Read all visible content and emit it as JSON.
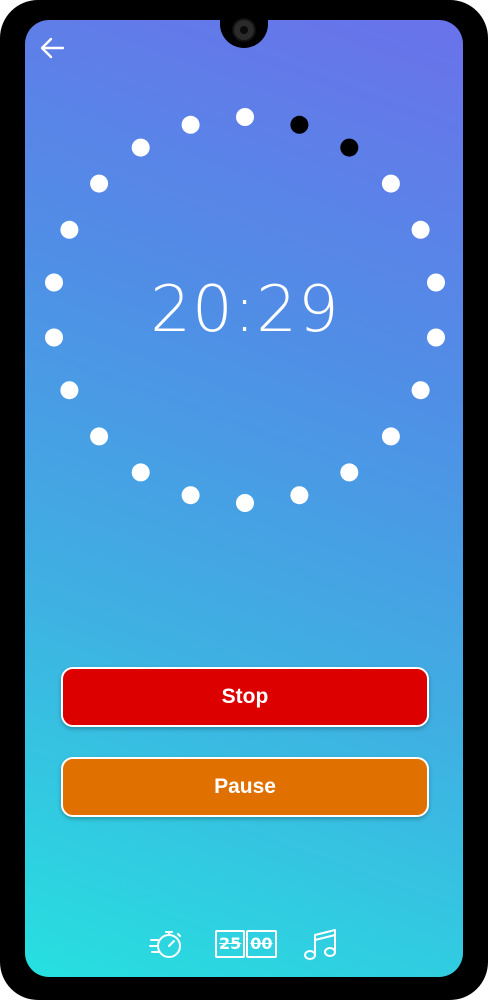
{
  "timer": {
    "display": "20:29"
  },
  "progress": {
    "dots_total": 22,
    "dots_completed": 2,
    "completed_color": "#000000",
    "remaining_color": "#ffffff"
  },
  "buttons": {
    "stop_label": "Stop",
    "pause_label": "Pause",
    "stop_color": "#dd0000",
    "pause_color": "#e07000"
  },
  "bottom_bar": {
    "timer_icon": "stopwatch-icon",
    "clock_minutes": "25",
    "clock_seconds": "00",
    "music_icon": "music-note-icon"
  },
  "nav": {
    "back_icon": "arrow-left-icon"
  }
}
